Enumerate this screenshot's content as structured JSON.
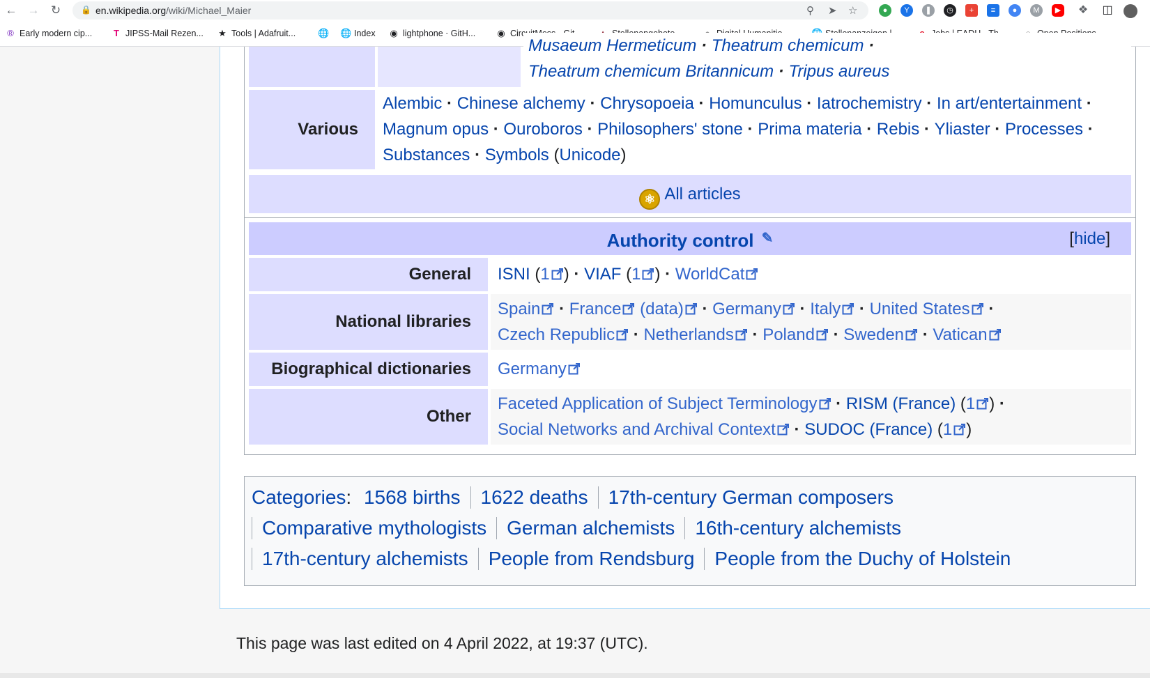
{
  "browser": {
    "url_host": "en.wikipedia.org",
    "url_path": "/wiki/Michael_Maier",
    "bookmarks": [
      {
        "label": "Early modern cip...",
        "icon": "circle-r-icon"
      },
      {
        "label": "JIPSS-Mail Rezen...",
        "icon": "telekom-icon"
      },
      {
        "label": "Tools | Adafruit...",
        "icon": "star-icon"
      },
      {
        "label": "",
        "icon": "globe-icon"
      },
      {
        "label": "Index",
        "icon": "globe-icon"
      },
      {
        "label": "lightphone · GitH...",
        "icon": "github-icon"
      },
      {
        "label": "CircuitMess · Git...",
        "icon": "github-icon"
      },
      {
        "label": "Stellenangebote...",
        "icon": "hat-icon"
      },
      {
        "label": "Digital Humanitie...",
        "icon": "dh-icon"
      },
      {
        "label": "Stellenanzeigen |...",
        "icon": "globe-icon"
      },
      {
        "label": "Jobs | EADH - Th...",
        "icon": "e-icon"
      },
      {
        "label": "Open Positions",
        "icon": "owl-icon"
      }
    ]
  },
  "navbox_alchemy": {
    "top_row": [
      "Musaeum Hermeticum",
      "Theatrum chemicum",
      "Theatrum chemicum Britannicum",
      "Tripus aureus"
    ],
    "various_label": "Various",
    "various_line1": [
      "Alembic",
      "Chinese alchemy",
      "Chrysopoeia",
      "Homunculus",
      "Iatrochemistry",
      "In art/entertainment"
    ],
    "various_line2": [
      "Magnum opus",
      "Ouroboros",
      "Philosophers' stone",
      "Prima materia",
      "Rebis",
      "Yliaster",
      "Processes"
    ],
    "various_line3_a": "Substances",
    "various_line3_b": "Symbols",
    "various_line3_c": "Unicode",
    "all_articles": "All articles"
  },
  "authority_control": {
    "title": "Authority control",
    "hide": "hide",
    "general_label": "General",
    "general": {
      "isni": "ISNI",
      "isni_n": "1",
      "viaf": "VIAF",
      "viaf_n": "1",
      "worldcat": "WorldCat"
    },
    "national_label": "National libraries",
    "national_line1": [
      "Spain",
      "France",
      "(data)",
      "Germany",
      "Italy",
      "United States"
    ],
    "national_line2": [
      "Czech Republic",
      "Netherlands",
      "Poland",
      "Sweden",
      "Vatican"
    ],
    "bio_label": "Biographical dictionaries",
    "bio": [
      "Germany"
    ],
    "other_label": "Other",
    "other_line1": {
      "fast": "Faceted Application of Subject Terminology",
      "rism": "RISM (France)",
      "rism_n": "1"
    },
    "other_line2": {
      "snac": "Social Networks and Archival Context",
      "sudoc": "SUDOC (France)",
      "sudoc_n": "1"
    }
  },
  "categories": {
    "label": "Categories",
    "line1": [
      "1568 births",
      "1622 deaths",
      "17th-century German composers"
    ],
    "line2": [
      "Comparative mythologists",
      "German alchemists",
      "16th-century alchemists"
    ],
    "line3": [
      "17th-century alchemists",
      "People from Rendsburg",
      "People from the Duchy of Holstein"
    ]
  },
  "footer": {
    "last_edited": "This page was last edited on 4 April 2022, at 19:37 (UTC)."
  },
  "colors": {
    "link": "#0645ad",
    "external_link": "#3366cc",
    "header_bg": "#ccccff",
    "group_bg": "#ddddff",
    "border": "#a2a9b1"
  }
}
